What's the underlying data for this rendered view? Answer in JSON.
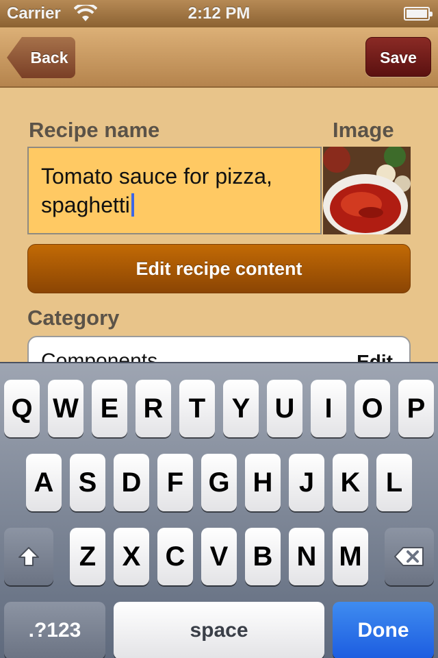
{
  "status_bar": {
    "carrier": "Carrier",
    "time": "2:12 PM"
  },
  "nav": {
    "back_label": "Back",
    "save_label": "Save"
  },
  "form": {
    "recipe_name_label": "Recipe name",
    "image_label": "Image",
    "recipe_name_line1": "Tomato sauce for pizza,",
    "recipe_name_line2": "spaghetti",
    "edit_content_label": "Edit recipe content",
    "category_label": "Category",
    "category_value": "Components",
    "category_edit_label": "Edit"
  },
  "keyboard": {
    "row1": [
      "Q",
      "W",
      "E",
      "R",
      "T",
      "Y",
      "U",
      "I",
      "O",
      "P"
    ],
    "row2": [
      "A",
      "S",
      "D",
      "F",
      "G",
      "H",
      "J",
      "K",
      "L"
    ],
    "row3": [
      "Z",
      "X",
      "C",
      "V",
      "B",
      "N",
      "M"
    ],
    "numbers_label": ".?123",
    "space_label": "space",
    "done_label": "Done"
  },
  "icons": {
    "wifi": "wifi-icon",
    "battery": "battery-icon",
    "shift": "shift-icon",
    "delete": "delete-icon"
  },
  "colors": {
    "background": "#e8c48a",
    "field": "#ffc963",
    "edit_button": "#a85804",
    "save_button": "#7a1c18",
    "done_button": "#2c72e8"
  }
}
